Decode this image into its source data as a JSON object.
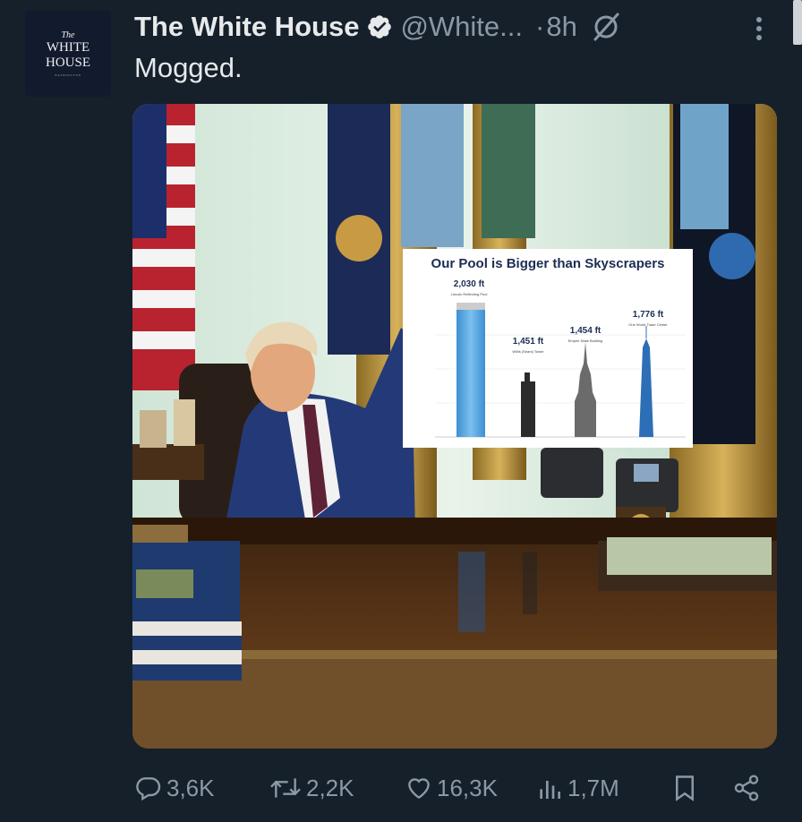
{
  "account": {
    "name": "The White House",
    "handle": "@White...",
    "time": "8h",
    "avatar": {
      "line1": "The",
      "line2": "WHITE",
      "line3": "HOUSE",
      "line4": "WASHINGTON"
    }
  },
  "tweet": {
    "text": "Mogged."
  },
  "poster": {
    "title": "Our Pool is Bigger than Skyscrapers",
    "items": [
      {
        "value": "2,030 ft",
        "label": "Lincoln Reflecting Pool"
      },
      {
        "value": "1,451 ft",
        "label": "Willis (Sears) Tower"
      },
      {
        "value": "1,454 ft",
        "label": "Empire State Building"
      },
      {
        "value": "1,776 ft",
        "label": "One World Trade Center"
      }
    ]
  },
  "stats": {
    "replies": "3,6K",
    "reposts": "2,2K",
    "likes": "16,3K",
    "views": "1,7M"
  },
  "colors": {
    "background": "#15202b",
    "text": "#e7e9ea",
    "muted": "#8b98a5",
    "verified": "#e7e9ea"
  },
  "icons": [
    "verified-badge-icon",
    "grok-icon",
    "more-icon",
    "reply-icon",
    "repost-icon",
    "like-icon",
    "views-icon",
    "bookmark-icon",
    "share-icon"
  ]
}
